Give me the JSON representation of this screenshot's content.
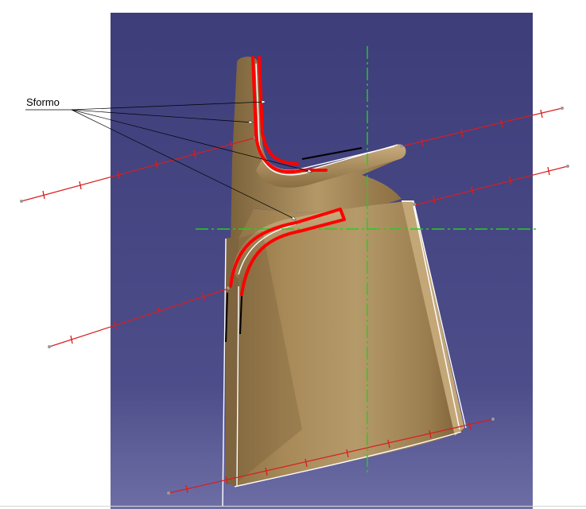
{
  "annotation": {
    "label": "Sformo"
  },
  "colors": {
    "page_background": "#ffffff",
    "viewport_top": "#3d3d7a",
    "viewport_bottom": "#6e6ea6",
    "part_body": "#a88a58",
    "part_highlight": "#c9ad7e",
    "part_shadow": "#6f5733",
    "draft_highlight": "#ff0000",
    "section_line": "#d81e1e",
    "axis_line": "#1fd11f",
    "edge": "#ffffff"
  }
}
